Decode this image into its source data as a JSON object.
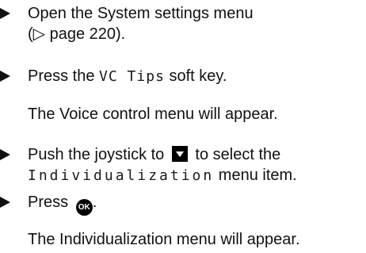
{
  "steps": [
    {
      "line1": "Open the System settings menu",
      "line2": "(▷ page 220)."
    },
    {
      "pre": "Press the ",
      "key": "VC Tips",
      "post": " soft key."
    },
    {
      "result": "The Voice control menu will appear."
    },
    {
      "pre": "Push the joystick to ",
      "post": " to select the",
      "item": "Individualization",
      "post2": " menu item."
    },
    {
      "pre": "Press ",
      "ok": "OK",
      "post": "."
    },
    {
      "result": "The Individualization menu will appear."
    }
  ],
  "icons": {
    "bullet": "triangle-right-icon",
    "down": "down-arrow-key-icon",
    "ok": "ok-button-icon"
  }
}
